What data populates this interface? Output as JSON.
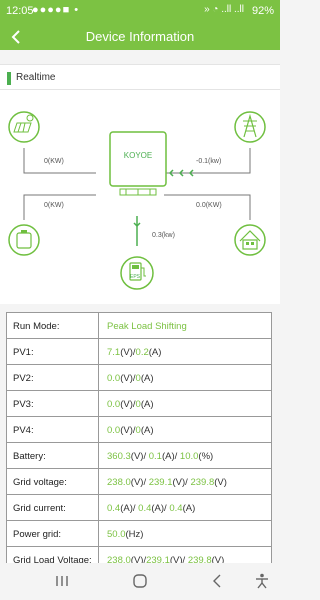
{
  "status": {
    "time": "12:05",
    "battery": "92%",
    "left_icons": "●●●●■ •",
    "right_icons": "» ◔ ..ll ..ll"
  },
  "header": {
    "title": "Device Information"
  },
  "section": {
    "title": "Realtime"
  },
  "diagram": {
    "brand": "KOYOE",
    "pv_power": "0(KW)",
    "grid_power": "-0.1(kw)",
    "battery_power": "0(KW)",
    "load_power": "0.0(KW)",
    "eps_power": "0.3(kw)",
    "eps_label": "EPS"
  },
  "table": {
    "rows": [
      {
        "key": "Run Mode:",
        "parts": [
          [
            "Peak Load Shifting",
            true
          ]
        ]
      },
      {
        "key": "PV1:",
        "parts": [
          [
            "7.1",
            true
          ],
          [
            "(V)/",
            false
          ],
          [
            "0.2",
            true
          ],
          [
            "(A)",
            false
          ]
        ]
      },
      {
        "key": "PV2:",
        "parts": [
          [
            "0.0",
            true
          ],
          [
            "(V)/",
            false
          ],
          [
            "0",
            true
          ],
          [
            "(A)",
            false
          ]
        ]
      },
      {
        "key": "PV3:",
        "parts": [
          [
            "0.0",
            true
          ],
          [
            "(V)/",
            false
          ],
          [
            "0",
            true
          ],
          [
            "(A)",
            false
          ]
        ]
      },
      {
        "key": "PV4:",
        "parts": [
          [
            "0.0",
            true
          ],
          [
            "(V)/",
            false
          ],
          [
            "0",
            true
          ],
          [
            "(A)",
            false
          ]
        ]
      },
      {
        "key": "Battery:",
        "parts": [
          [
            "360.3",
            true
          ],
          [
            "(V)/ ",
            false
          ],
          [
            "0.1",
            true
          ],
          [
            "(A)/ ",
            false
          ],
          [
            "10.0",
            true
          ],
          [
            "(%)",
            false
          ]
        ]
      },
      {
        "key": "Grid voltage:",
        "parts": [
          [
            "238.0",
            true
          ],
          [
            "(V)/ ",
            false
          ],
          [
            "239.1",
            true
          ],
          [
            "(V)/ ",
            false
          ],
          [
            "239.8",
            true
          ],
          [
            "(V)",
            false
          ]
        ]
      },
      {
        "key": "Grid current:",
        "parts": [
          [
            "0.4",
            true
          ],
          [
            "(A)/ ",
            false
          ],
          [
            "0.4",
            true
          ],
          [
            "(A)/ ",
            false
          ],
          [
            "0.4",
            true
          ],
          [
            "(A)",
            false
          ]
        ]
      },
      {
        "key": "Power grid:",
        "parts": [
          [
            "50.0",
            true
          ],
          [
            "(Hz)",
            false
          ]
        ]
      },
      {
        "key": "Grid Load Voltage:",
        "parts": [
          [
            "238.0",
            true
          ],
          [
            "(V)/",
            false
          ],
          [
            "239.1",
            true
          ],
          [
            "(V)/ ",
            false
          ],
          [
            "239.8",
            true
          ],
          [
            "(V)",
            false
          ]
        ]
      }
    ]
  },
  "colors": {
    "accent": "#7cc243",
    "value_green": "#7cc243",
    "flow_green": "#4caf50"
  },
  "icons": [
    "back-arrow-icon",
    "solar-panel-icon",
    "grid-tower-icon",
    "battery-icon",
    "home-icon",
    "eps-icon",
    "inverter-icon"
  ]
}
